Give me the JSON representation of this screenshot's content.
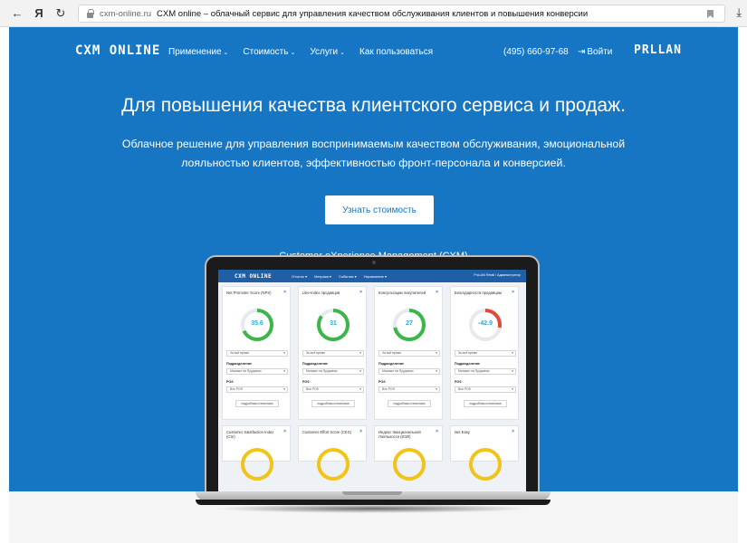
{
  "browser": {
    "back": "←",
    "yandex": "Я",
    "reload": "↻",
    "domain": "cxm-online.ru",
    "title": "CXM online – облачный сервис для управления качеством обслуживания клиентов и повышения конверсии",
    "download": "⤓"
  },
  "nav": {
    "logo": "CXM ONLINE",
    "menu": [
      {
        "label": "Применение",
        "caret": "⌄"
      },
      {
        "label": "Стоимость",
        "caret": "⌄"
      },
      {
        "label": "Услуги",
        "caret": "⌄"
      },
      {
        "label": "Как пользоваться",
        "caret": ""
      }
    ],
    "phone": "(495) 660-97-68",
    "login": "Войти",
    "login_icon": "⇥",
    "brand2": "PRLLAN"
  },
  "hero": {
    "headline": "Для повышения качества клиентского сервиса и продаж.",
    "sub": "Облачное решение для управления воспринимаемым качеством обслуживания, эмоциональной лояльностью клиентов, эффективностью фронт-персонала и конверсией.",
    "cta": "Узнать стоимость",
    "caption": "Customer eXperience Management (CXM)"
  },
  "app": {
    "logo": "CXM ONLINE",
    "menu": [
      "Отчеты ▾",
      "Метрики ▾",
      "События ▾",
      "Управление ▾"
    ],
    "user": "ProLAN Retail / Администратор",
    "cards": [
      {
        "title": "Net Promoter Score (NPS)",
        "value": "35.6",
        "fraction": 0.68,
        "color": "#3cb54a"
      },
      {
        "title": "Like-Index продавцов",
        "value": "31",
        "fraction": 0.85,
        "color": "#3cb54a"
      },
      {
        "title": "Консультации покупателей",
        "value": "27",
        "fraction": 0.72,
        "color": "#3cb54a"
      },
      {
        "title": "Благодарности продавцам",
        "value": "-42.9",
        "fraction": 0.28,
        "color": "#e04a3a"
      }
    ],
    "period": "За всё время",
    "dept_label": "Подразделение",
    "dept_value": "Магазин на Прудовом",
    "pos_label": "POS",
    "pos_value": "Все POS",
    "stats_btn": "подробная статистика",
    "cards2": [
      {
        "title": "Customer Satisfaction Index (CSI)"
      },
      {
        "title": "Customer Effort Score (CES)"
      },
      {
        "title": "Индекс Эмоциональной Лояльности (ИЭЛ)"
      },
      {
        "title": "Net Easy"
      }
    ],
    "close_icon": "×"
  }
}
